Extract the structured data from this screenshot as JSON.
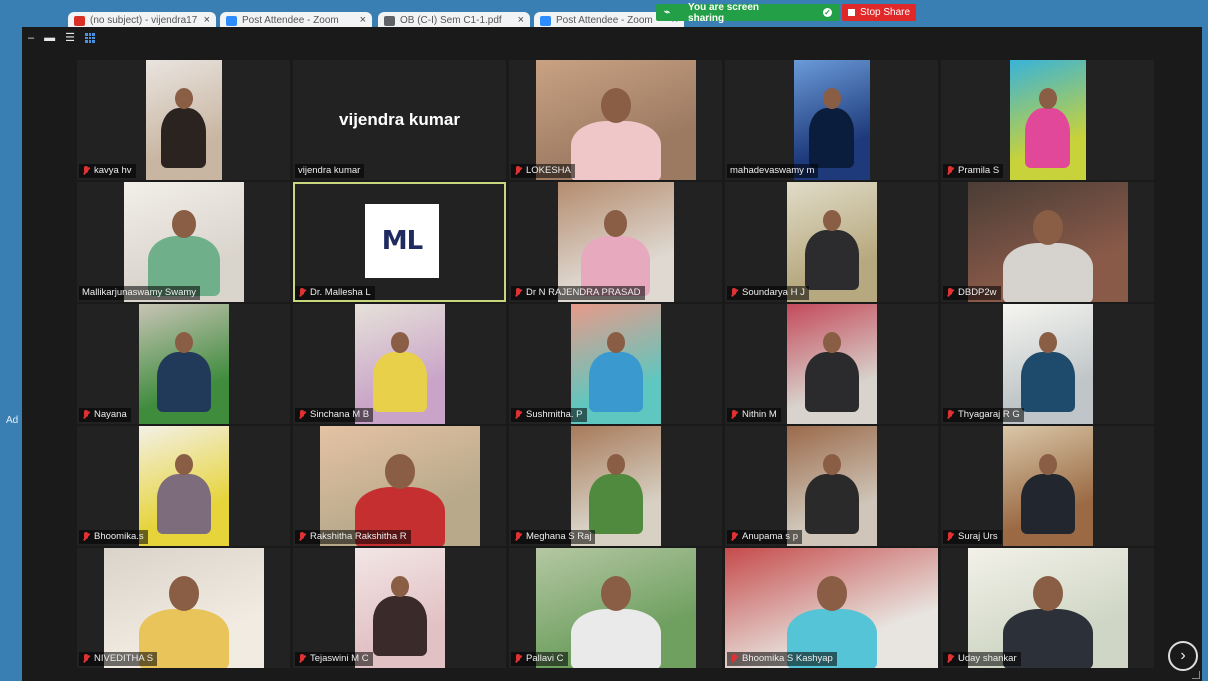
{
  "browser": {
    "tabs": [
      {
        "title": "(no subject) - vijendra17",
        "icon_color": "#d93025"
      },
      {
        "title": "Post Attendee - Zoom",
        "icon_color": "#2d8cff"
      },
      {
        "title": "OB (C-I) Sem C1-1.pdf",
        "icon_color": "#5f6368"
      },
      {
        "title": "Post Attendee - Zoom",
        "icon_color": "#2d8cff"
      }
    ],
    "side_label": "Ad"
  },
  "share": {
    "banner_text": "You are screen sharing",
    "stop_label": "Stop Share"
  },
  "participants": [
    {
      "name": "kavya hv",
      "muted": true,
      "kind": "photo",
      "pic_color": "#c9b6a2",
      "figure_color": "#2b2320",
      "bg2": "#e9e4df"
    },
    {
      "name": "vijendra kumar",
      "muted": false,
      "kind": "name-only"
    },
    {
      "name": "LOKESHA",
      "muted": true,
      "kind": "video",
      "pic_color": "#9c7a62",
      "figure_color": "#f0c7c9",
      "bg2": "#c9a283"
    },
    {
      "name": "mahadevaswamy m",
      "muted": false,
      "kind": "photo",
      "pic_color": "#1e3a7a",
      "figure_color": "#0b1d3d",
      "bg2": "#6a9ad8"
    },
    {
      "name": "Pramila S",
      "muted": true,
      "kind": "photo",
      "pic_color": "#c8d23a",
      "figure_color": "#e2489a",
      "bg2": "#38b3d9"
    },
    {
      "name": "Mallikarjunaswamy Swamy",
      "muted": false,
      "kind": "video",
      "pic_color": "#d9d4cc",
      "figure_color": "#6fb08a",
      "bg2": "#f2efe9"
    },
    {
      "name": "Dr. Mallesha L",
      "muted": true,
      "kind": "logo",
      "logo_text": "ML",
      "active": true
    },
    {
      "name": "Dr N RAJENDRA PRASAD",
      "muted": true,
      "kind": "video",
      "pic_color": "#dfd9d2",
      "figure_color": "#e7a9bd",
      "bg2": "#b58c6e"
    },
    {
      "name": "Soundarya H J",
      "muted": true,
      "kind": "video",
      "pic_color": "#b7a97f",
      "figure_color": "#2c2b2e",
      "bg2": "#e1dcc8"
    },
    {
      "name": "DBDP2w",
      "muted": true,
      "kind": "video",
      "pic_color": "#8a5a49",
      "figure_color": "#d6d3cf",
      "bg2": "#4a3d36"
    },
    {
      "name": "Nayana",
      "muted": true,
      "kind": "video",
      "pic_color": "#3f8c3d",
      "figure_color": "#213a5a",
      "bg2": "#c8c4b5"
    },
    {
      "name": "Sinchana M B",
      "muted": true,
      "kind": "video",
      "pic_color": "#c9a4c8",
      "figure_color": "#e8d04a",
      "bg2": "#e6e1d9"
    },
    {
      "name": "Sushmitha. P",
      "muted": true,
      "kind": "video",
      "pic_color": "#5fc7bf",
      "figure_color": "#3a9ad0",
      "bg2": "#e89a8a"
    },
    {
      "name": "Nithin M",
      "muted": true,
      "kind": "video",
      "pic_color": "#d8d4cd",
      "figure_color": "#2b2b2d",
      "bg2": "#c44a5b"
    },
    {
      "name": "Thyagaraj R G",
      "muted": true,
      "kind": "video",
      "pic_color": "#bfc5c8",
      "figure_color": "#1e4a6b",
      "bg2": "#f6f6f1"
    },
    {
      "name": "Bhoomika.s",
      "muted": true,
      "kind": "video",
      "pic_color": "#e6d43a",
      "figure_color": "#7d6c7c",
      "bg2": "#f3f0e6"
    },
    {
      "name": "Rakshitha Rakshitha R",
      "muted": true,
      "kind": "video",
      "pic_color": "#b7a98a",
      "figure_color": "#c62f2f",
      "bg2": "#e5c2a4"
    },
    {
      "name": "Meghana S Raj",
      "muted": true,
      "kind": "video",
      "pic_color": "#d7d1c4",
      "figure_color": "#4f8a3e",
      "bg2": "#a87a5a"
    },
    {
      "name": "Anupama s p",
      "muted": true,
      "kind": "video",
      "pic_color": "#cfc6b9",
      "figure_color": "#2a2a2a",
      "bg2": "#9b6a4a"
    },
    {
      "name": "Suraj Urs",
      "muted": true,
      "kind": "video",
      "pic_color": "#9b6a44",
      "figure_color": "#22262e",
      "bg2": "#d9c7a8"
    },
    {
      "name": "NIVEDITHA S",
      "muted": true,
      "kind": "video",
      "pic_color": "#f1ebe2",
      "figure_color": "#e8c45a",
      "bg2": "#d9d3c9"
    },
    {
      "name": "Tejaswini M C",
      "muted": true,
      "kind": "video",
      "pic_color": "#e2c1c4",
      "figure_color": "#3b2a2a",
      "bg2": "#f2e6e6"
    },
    {
      "name": "Pallavi C",
      "muted": true,
      "kind": "video",
      "pic_color": "#6fa060",
      "figure_color": "#eaeaea",
      "bg2": "#b5c7a3"
    },
    {
      "name": "Bhoomika S Kashyap",
      "muted": true,
      "kind": "video",
      "pic_color": "#e8e4df",
      "figure_color": "#55c4d6",
      "bg2": "#c54b4b"
    },
    {
      "name": "Uday shankar",
      "muted": true,
      "kind": "video",
      "pic_color": "#cfd6c5",
      "figure_color": "#2c3038",
      "bg2": "#f3f1e9"
    }
  ],
  "controls": {
    "next_page_glyph": "›"
  }
}
